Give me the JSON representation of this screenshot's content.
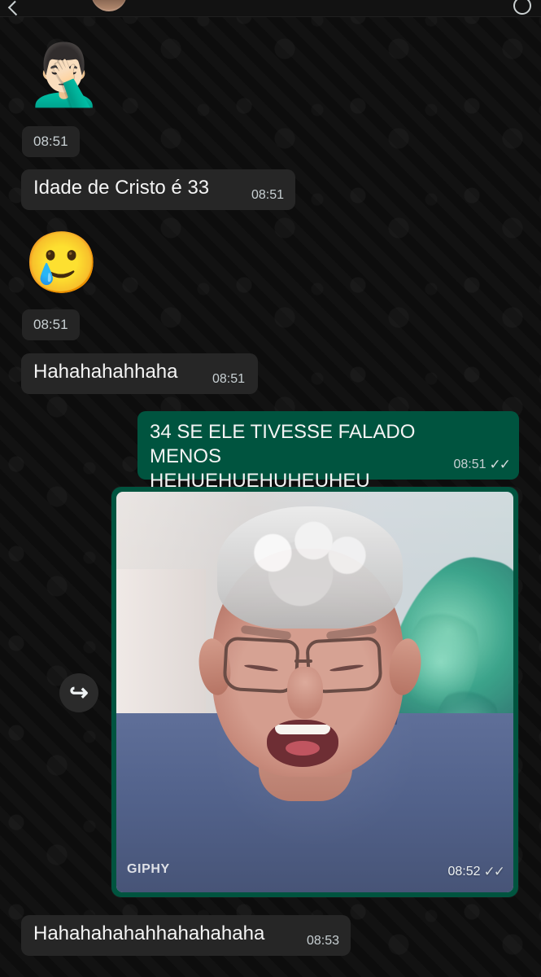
{
  "header": {
    "back_icon": "back-arrow-icon",
    "avatar_icon": "contact-avatar",
    "action_icon": "call-icon"
  },
  "messages": [
    {
      "kind": "emoji",
      "emoji": "🤦🏻‍♂️",
      "time": "08:51"
    },
    {
      "kind": "incoming-text",
      "text": "Idade de Cristo é 33",
      "time": "08:51"
    },
    {
      "kind": "emoji",
      "emoji": "🥲",
      "time": "08:51"
    },
    {
      "kind": "incoming-text",
      "text": "Hahahahahhaha",
      "time": "08:51"
    },
    {
      "kind": "outgoing-text",
      "text": "34 SE ELE TIVESSE FALADO MENOS\nHEHUEHUEHUHEUHEU",
      "time": "08:51",
      "status": "✓✓"
    },
    {
      "kind": "outgoing-gif",
      "overlay_label": "GIPHY",
      "time": "08:52",
      "status": "✓✓",
      "forward_icon": "↪"
    },
    {
      "kind": "incoming-text",
      "text": "Hahahahahahhahahahaha",
      "time": "08:53"
    }
  ],
  "colors": {
    "background": "#0d0d0d",
    "incoming_bubble": "#262626",
    "outgoing_bubble": "#00543f",
    "time_text": "#c8d0d3"
  }
}
